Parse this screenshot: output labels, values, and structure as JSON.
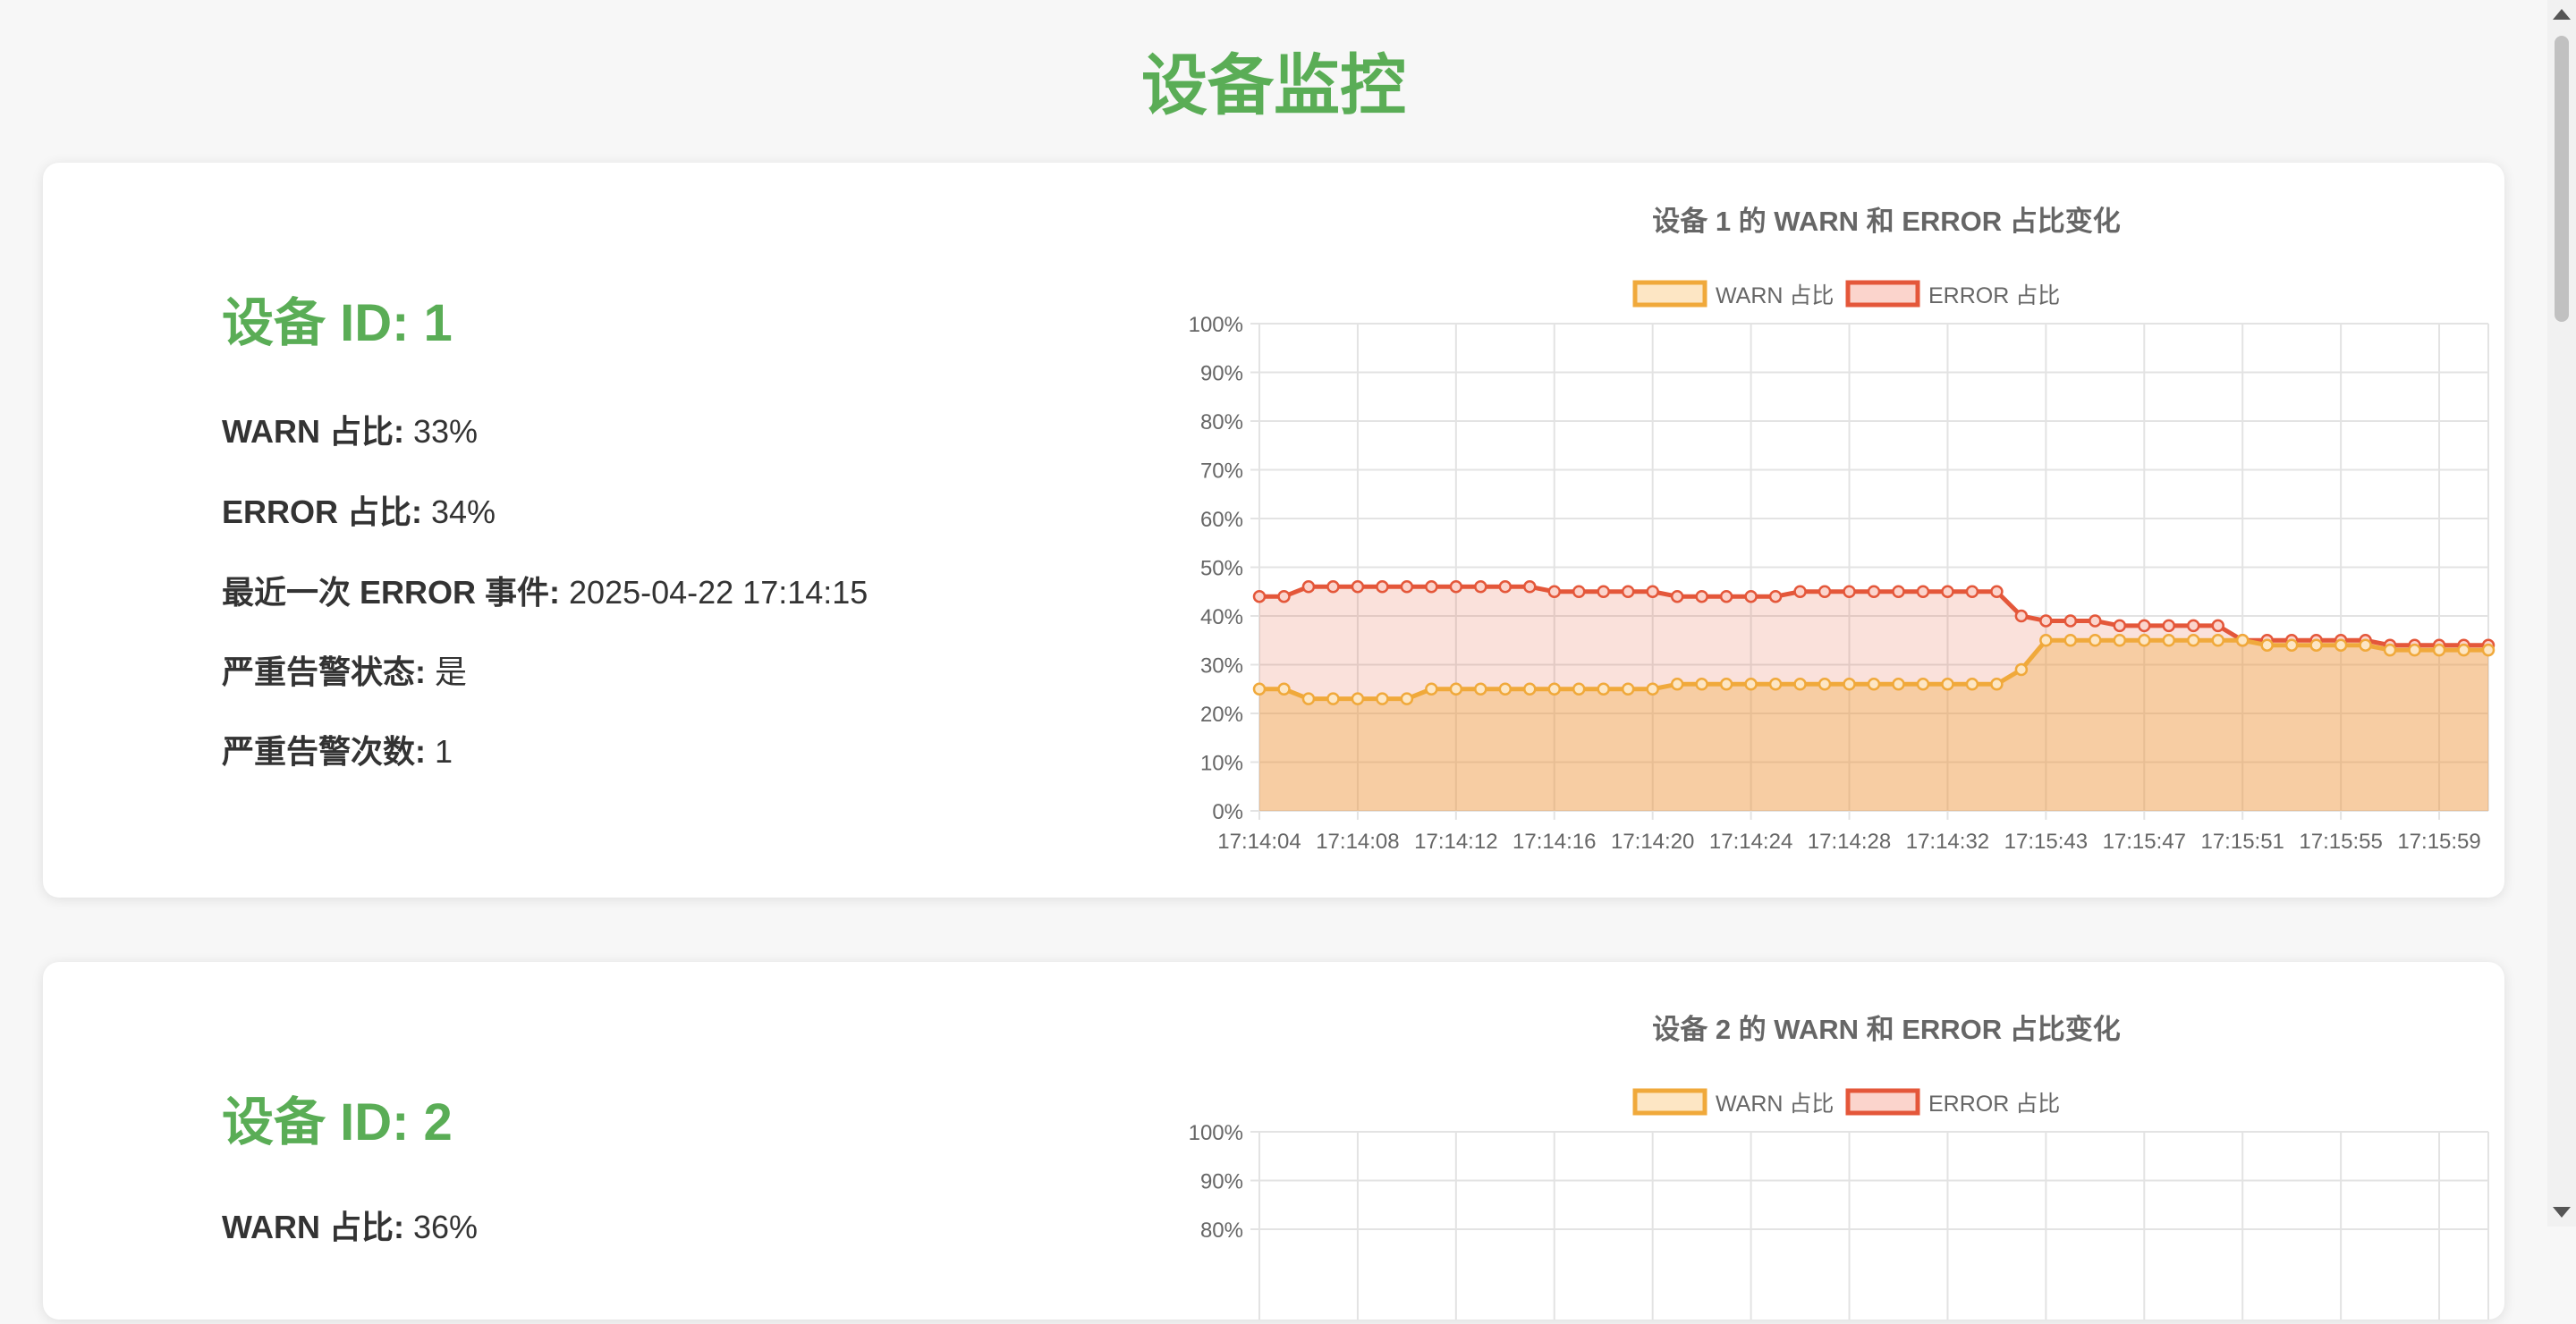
{
  "page": {
    "title": "设备监控"
  },
  "devices": [
    {
      "id_label": "设备 ID: 1",
      "warn_label": "WARN 占比:",
      "warn_value": "33%",
      "error_label": "ERROR 占比:",
      "error_value": "34%",
      "last_error_label": "最近一次 ERROR 事件:",
      "last_error_value": "2025-04-22 17:14:15",
      "alarm_status_label": "严重告警状态:",
      "alarm_status_value": "是",
      "alarm_count_label": "严重告警次数:",
      "alarm_count_value": "1",
      "chart_title": "设备 1 的 WARN 和 ERROR 占比变化"
    },
    {
      "id_label": "设备 ID: 2",
      "warn_label": "WARN 占比:",
      "warn_value": "36%",
      "chart_title": "设备 2 的 WARN 和 ERROR 占比变化"
    }
  ],
  "colors": {
    "title": "#5aad56",
    "warn": "#f0a93b",
    "error": "#e4573a"
  },
  "chart_data": [
    {
      "type": "area",
      "title": "设备 1 的 WARN 和 ERROR 占比变化",
      "ylim": [
        0,
        100
      ],
      "y_ticks": [
        "0%",
        "10%",
        "20%",
        "30%",
        "40%",
        "50%",
        "60%",
        "70%",
        "80%",
        "90%",
        "100%"
      ],
      "x_tick_labels": [
        "17:14:04",
        "17:14:08",
        "17:14:12",
        "17:14:16",
        "17:14:20",
        "17:14:24",
        "17:14:28",
        "17:14:32",
        "17:15:43",
        "17:15:47",
        "17:15:51",
        "17:15:55",
        "17:15:59"
      ],
      "legend_position": "top-center",
      "grid": true,
      "series": [
        {
          "name": "WARN 占比",
          "color": "#f0a93b",
          "values": [
            25,
            25,
            23,
            23,
            23,
            23,
            23,
            25,
            25,
            25,
            25,
            25,
            25,
            25,
            25,
            25,
            25,
            26,
            26,
            26,
            26,
            26,
            26,
            26,
            26,
            26,
            26,
            26,
            26,
            26,
            26,
            29,
            35,
            35,
            35,
            35,
            35,
            35,
            35,
            35,
            35,
            34,
            34,
            34,
            34,
            34,
            33,
            33,
            33,
            33,
            33
          ]
        },
        {
          "name": "ERROR 占比",
          "color": "#e4573a",
          "values": [
            44,
            44,
            46,
            46,
            46,
            46,
            46,
            46,
            46,
            46,
            46,
            46,
            45,
            45,
            45,
            45,
            45,
            44,
            44,
            44,
            44,
            44,
            45,
            45,
            45,
            45,
            45,
            45,
            45,
            45,
            45,
            40,
            39,
            39,
            39,
            38,
            38,
            38,
            38,
            38,
            35,
            35,
            35,
            35,
            35,
            35,
            34,
            34,
            34,
            34,
            34
          ]
        }
      ]
    },
    {
      "type": "area",
      "title": "设备 2 的 WARN 和 ERROR 占比变化",
      "ylim": [
        0,
        100
      ],
      "y_ticks": [
        "80%",
        "90%",
        "100%"
      ],
      "legend_position": "top-center",
      "grid": true,
      "series": [
        {
          "name": "WARN 占比",
          "color": "#f0a93b",
          "values": []
        },
        {
          "name": "ERROR 占比",
          "color": "#e4573a",
          "values": []
        }
      ]
    }
  ]
}
